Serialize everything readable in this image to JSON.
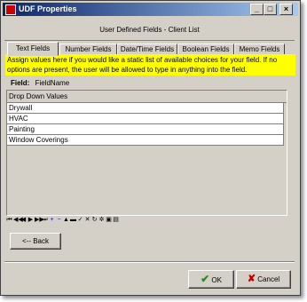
{
  "window": {
    "title": "UDF Properties",
    "minimize": "_",
    "maximize": "□",
    "close": "×"
  },
  "header": {
    "title": "User Defined Fields - Client List"
  },
  "tabs": [
    {
      "label": "Text Fields",
      "active": true
    },
    {
      "label": "Number Fields"
    },
    {
      "label": "Date/Time Fields"
    },
    {
      "label": "Boolean Fields"
    },
    {
      "label": "Memo Fields"
    }
  ],
  "info": {
    "line1": "Assign values here if you would like a static list of available choices for your field.  If no",
    "line2": "options are present, the user will be allowed to type in anything into the field."
  },
  "field": {
    "label": "Field:",
    "value": "FieldName"
  },
  "grid": {
    "header": "Drop Down Values",
    "rows": [
      "Drywall",
      "HVAC",
      "Painting",
      "Window Coverings"
    ]
  },
  "navigator": {
    "buttons": [
      "first-icon",
      "prior-page-icon",
      "prior-icon",
      "next-icon",
      "next-page-icon",
      "last-icon",
      "insert-icon",
      "delete-icon",
      "edit-icon",
      "post-icon",
      "cancel-icon",
      "refresh-icon",
      "apply-icon",
      "filter-icon",
      "cancel-filter-icon",
      "options-icon"
    ]
  },
  "buttons": {
    "back": "<-- Back",
    "ok": "OK",
    "cancel": "Cancel"
  },
  "colors": {
    "info_bg": "#ffff00",
    "titlebar": "#0a246a"
  }
}
